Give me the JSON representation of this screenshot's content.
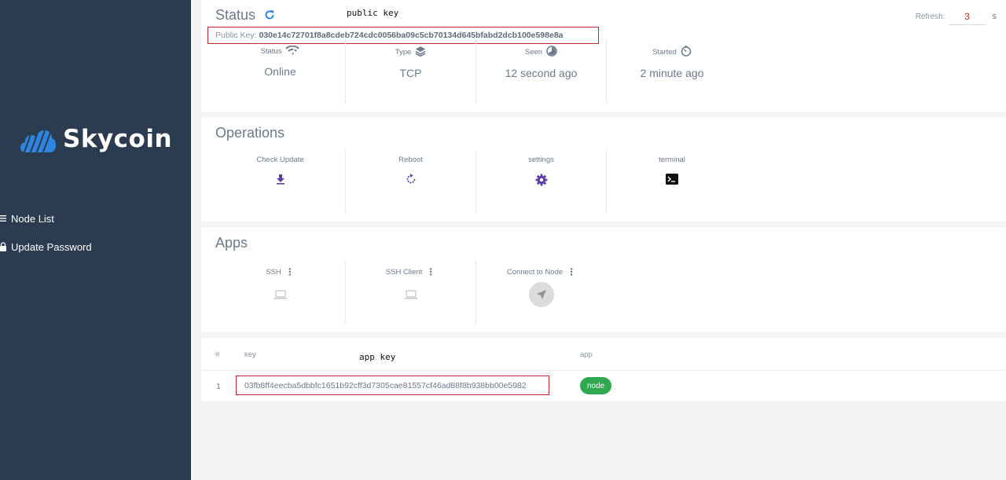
{
  "sidebar": {
    "logo_text": "Skycoin",
    "items": [
      {
        "label": "Node List",
        "icon": "list-icon"
      },
      {
        "label": "Update Password",
        "icon": "lock-icon"
      }
    ]
  },
  "status": {
    "title": "Status",
    "annotation": "public key",
    "public_key_label": "Public Key:",
    "public_key_value": "030e14c72701f8a8cdeb724cdc0056ba09c5cb70134d645bfabd2dcb100e598e8a",
    "refresh_label": "Refresh:",
    "refresh_value": "3",
    "refresh_unit": "s",
    "cells": [
      {
        "label": "Status",
        "value": "Online",
        "icon": "wifi-icon"
      },
      {
        "label": "Type",
        "value": "TCP",
        "icon": "layers-icon"
      },
      {
        "label": "Seen",
        "value": "12 second ago",
        "icon": "pie-clock-icon"
      },
      {
        "label": "Started",
        "value": "2 minute ago",
        "icon": "timer-icon"
      }
    ]
  },
  "operations": {
    "title": "Operations",
    "items": [
      {
        "label": "Check Update",
        "icon": "download-icon"
      },
      {
        "label": "Reboot",
        "icon": "reboot-icon"
      },
      {
        "label": "settings",
        "icon": "gear-icon"
      },
      {
        "label": "terminal",
        "icon": "terminal-icon"
      }
    ]
  },
  "apps": {
    "title": "Apps",
    "items": [
      {
        "label": "SSH",
        "icon": "laptop-icon"
      },
      {
        "label": "SSH Client",
        "icon": "laptop-icon"
      },
      {
        "label": "Connect to Node",
        "icon": "send-icon"
      }
    ]
  },
  "table": {
    "headers": {
      "index": "#",
      "key": "key",
      "app": "app"
    },
    "annotation": "app key",
    "rows": [
      {
        "index": "1",
        "key": "03fb8ff4eecba5dbbfc1651b92cff3d7305cae81557cf46ad88f8b938bb00e5982",
        "app": "node"
      }
    ]
  },
  "colors": {
    "sidebar": "#2b3b50",
    "accent_blue": "#2f86e0",
    "accent_purple": "#5b3fa6",
    "highlight_red": "#c0282d",
    "badge_green": "#2fa84f"
  }
}
